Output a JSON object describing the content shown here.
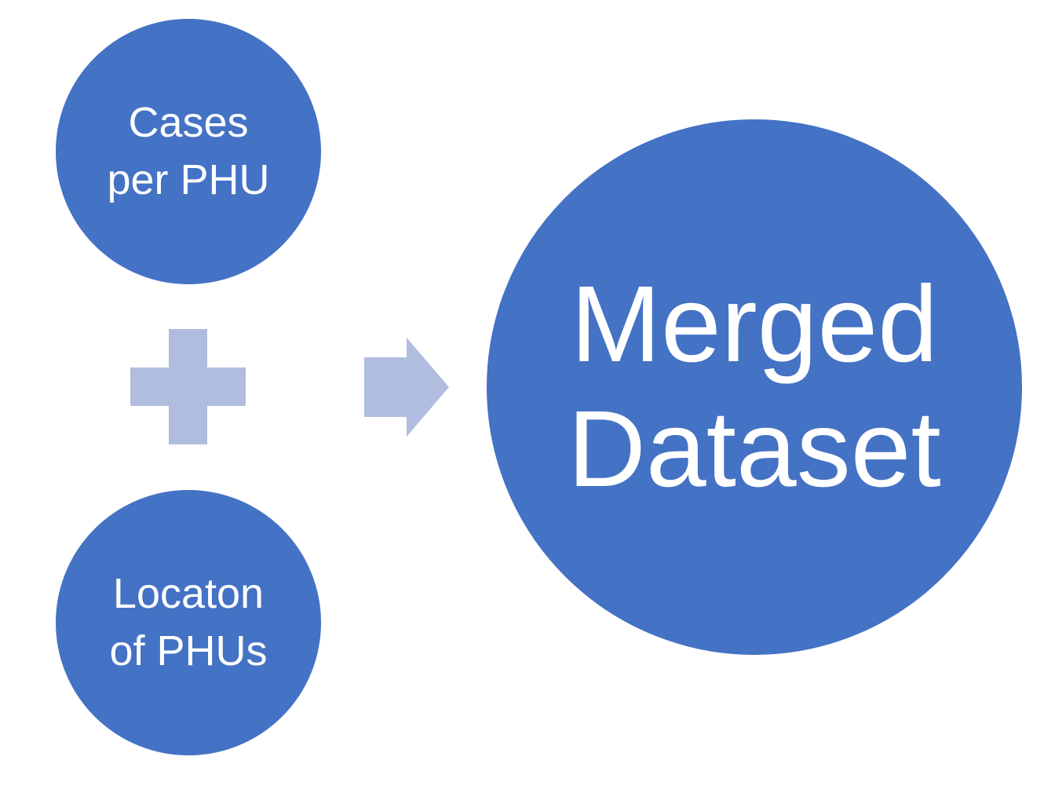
{
  "colors": {
    "circle_fill": "#4472c4",
    "connector_fill": "#b0bddf",
    "text": "#ffffff",
    "background": "#ffffff"
  },
  "nodes": {
    "cases": {
      "lines": [
        "Cases",
        "per PHU"
      ]
    },
    "location": {
      "lines": [
        "Locaton",
        "of PHUs"
      ]
    },
    "merged": {
      "lines": [
        "Merged",
        "Dataset"
      ]
    }
  },
  "connectors": {
    "plus_icon": "plus-icon",
    "arrow_icon": "arrow-right-icon"
  }
}
